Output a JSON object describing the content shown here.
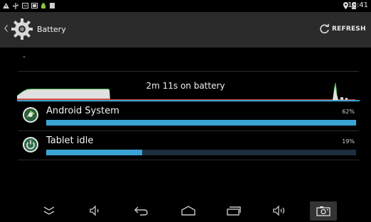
{
  "status_bar": {
    "time": "16:41",
    "icons": [
      "warning-icon",
      "usb-icon",
      "download-icon",
      "screenshot-icon",
      "android-icon",
      "notification-icon",
      "location-icon",
      "battery-icon"
    ]
  },
  "action_bar": {
    "title": "Battery",
    "app_icon": "settings-gear-icon",
    "refresh_label": "REFRESH"
  },
  "battery": {
    "status_text": "-",
    "time_on_battery": "2m 11s on battery"
  },
  "apps": [
    {
      "name": "Android System",
      "percent_label": "62%",
      "usage_fraction": 1.0,
      "icon": "android-system-icon"
    },
    {
      "name": "Tablet idle",
      "percent_label": "19%",
      "usage_fraction": 0.31,
      "icon": "power-icon"
    }
  ],
  "nav_bar": {
    "buttons": [
      "hide-bar-icon",
      "volume-down-icon",
      "back-icon",
      "home-icon",
      "recent-apps-icon",
      "volume-up-icon",
      "camera-icon"
    ]
  },
  "colors": {
    "bar_fill": "#3aa3d6",
    "bar_track": "#1c2e3d",
    "graph_fill": "#e0e0e0",
    "graph_plug": "#d34a3a",
    "graph_line": "#4caf50"
  }
}
